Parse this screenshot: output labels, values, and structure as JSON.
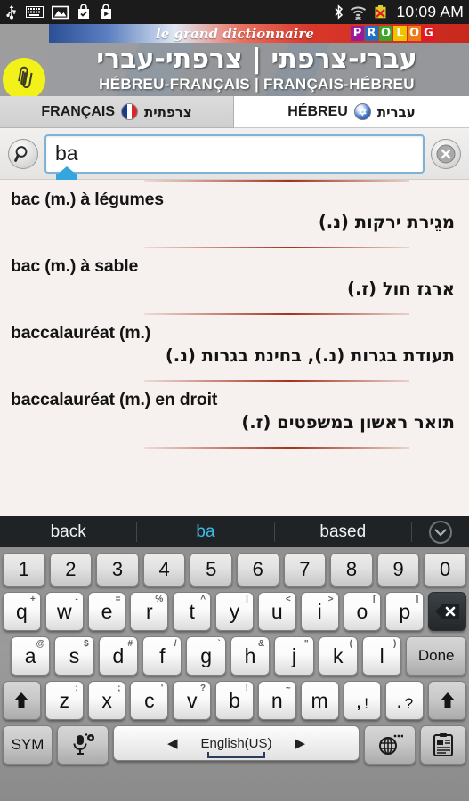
{
  "status_bar": {
    "icons": [
      "usb-icon",
      "keyboard-icon",
      "image-icon",
      "bag-check-icon",
      "bag-play-icon"
    ],
    "right_icons": [
      "bluetooth-icon",
      "wifi-icon",
      "battery-error-icon"
    ],
    "time": "10:09 AM"
  },
  "banner": {
    "script_title": "le grand dictionnaire",
    "brand_letters": [
      "P",
      "R",
      "O",
      "L",
      "O",
      "G"
    ],
    "brand_colors": [
      "#9a1b9a",
      "#1f6fc4",
      "#3aa52a",
      "#f2c400",
      "#ef7a18",
      "#e01b24"
    ],
    "hebrew_title": "עברי-צרפתי | צרפתי-עברי",
    "french_title": "HÉBREU-FRANÇAIS | FRANÇAIS-HÉBREU",
    "clip_icon": "paperclip-icon"
  },
  "tabs": [
    {
      "label": "FRANÇAIS",
      "native": "צרפתית",
      "icon": "french-flag-icon",
      "active": true
    },
    {
      "label": "HÉBREU",
      "native": "עברית",
      "icon": "israel-flag-icon",
      "active": false
    }
  ],
  "search": {
    "icon": "search-icon",
    "value": "ba",
    "placeholder": "",
    "clear_icon": "clear-icon",
    "cursor_handle": "text-cursor-handle"
  },
  "results": [
    {
      "fr": "bac (m.) à légumes",
      "he": "מגֵירת ירקות (נ.)"
    },
    {
      "fr": "bac (m.) à sable",
      "he": "ארגז חול (ז.)"
    },
    {
      "fr": "baccalauréat (m.)",
      "he": "תעודת בגרות (נ.), בחינת בגרות (נ.)"
    },
    {
      "fr": "baccalauréat (m.) en droit",
      "he": "תואר ראשון במשפטים (ז.)"
    }
  ],
  "suggestions": {
    "items": [
      {
        "text": "back",
        "current": false
      },
      {
        "text": "ba",
        "current": true
      },
      {
        "text": "based",
        "current": false
      }
    ],
    "expand_icon": "chevron-down-icon"
  },
  "keyboard": {
    "accent_color": "#3dbde8",
    "number_row": [
      "1",
      "2",
      "3",
      "4",
      "5",
      "6",
      "7",
      "8",
      "9",
      "0"
    ],
    "row1": [
      {
        "key": "q",
        "alt": "+"
      },
      {
        "key": "w",
        "alt": "-"
      },
      {
        "key": "e",
        "alt": "="
      },
      {
        "key": "r",
        "alt": "%"
      },
      {
        "key": "t",
        "alt": "^"
      },
      {
        "key": "y",
        "alt": "|"
      },
      {
        "key": "u",
        "alt": "<"
      },
      {
        "key": "i",
        "alt": ">"
      },
      {
        "key": "o",
        "alt": "["
      },
      {
        "key": "p",
        "alt": "]"
      }
    ],
    "backspace_icon": "backspace-icon",
    "row2": [
      {
        "key": "a",
        "alt": "@"
      },
      {
        "key": "s",
        "alt": "$"
      },
      {
        "key": "d",
        "alt": "#"
      },
      {
        "key": "f",
        "alt": "/"
      },
      {
        "key": "g",
        "alt": "`"
      },
      {
        "key": "h",
        "alt": "&"
      },
      {
        "key": "j",
        "alt": "\""
      },
      {
        "key": "k",
        "alt": "("
      },
      {
        "key": "l",
        "alt": ")"
      }
    ],
    "done_label": "Done",
    "shift_icon": "shift-icon",
    "row3": [
      {
        "key": "z",
        "alt": ":"
      },
      {
        "key": "x",
        "alt": ";"
      },
      {
        "key": "c",
        "alt": "'"
      },
      {
        "key": "v",
        "alt": "?"
      },
      {
        "key": "b",
        "alt": "!"
      },
      {
        "key": "n",
        "alt": "~"
      },
      {
        "key": "m",
        "alt": "_"
      }
    ],
    "comma_key": {
      "main": ",",
      "alt": "!"
    },
    "period_key": {
      "main": ".",
      "alt": "?"
    },
    "sym_label": "SYM",
    "mic_icon": "mic-settings-icon",
    "space_label": "English(US)",
    "space_prev_icon": "arrow-left-icon",
    "space_next_icon": "arrow-right-icon",
    "globe_icon": "globe-icon",
    "clipboard_icon": "clipboard-icon"
  }
}
